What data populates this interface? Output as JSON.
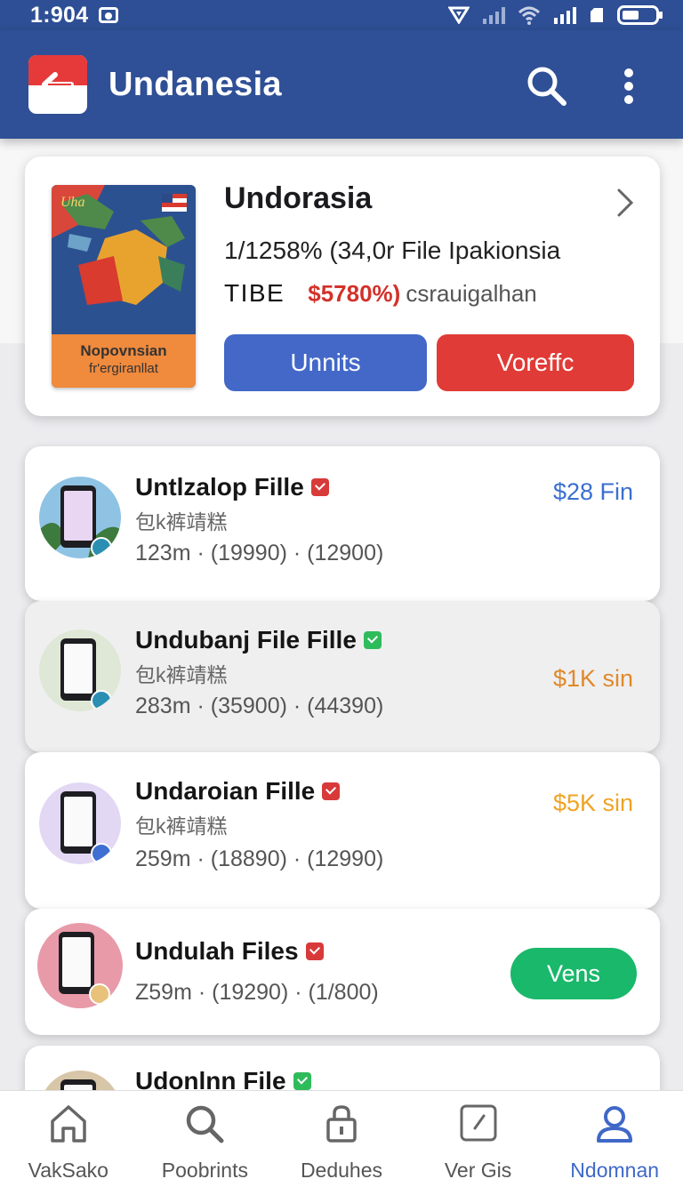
{
  "status_bar": {
    "time": "1:904"
  },
  "app_bar": {
    "title": "Undanesia"
  },
  "hero": {
    "title": "Undorasia",
    "line2": "1/1258% (34,0r File Ipakionsia",
    "tag": "TIBE",
    "price": "$5780%)",
    "price_note": "csrauigalhan",
    "book_title": "Nopovnsian",
    "book_subtitle": "fr'ergiranllat",
    "primary_button": "Unnits",
    "secondary_button": "Voreffc"
  },
  "list": [
    {
      "name": "Untlzalop Fille",
      "sub": "包k裤靖糕",
      "meta": "123m · (19990) · (12900)",
      "amount": "$28 Fin",
      "amount_color": "#3a6fd0",
      "badge": "red"
    },
    {
      "name": "Undubanj File Fille",
      "sub": "包k裤靖糕",
      "meta": "283m · (35900) · (44390)",
      "amount": "$1K sin",
      "amount_color": "#e0892a",
      "badge": "green"
    },
    {
      "name": "Undaroian Fille",
      "sub": "包k裤靖糕",
      "meta": "259m · (18890) · (12990)",
      "amount": "$5K sin",
      "amount_color": "#f0a323",
      "badge": "red"
    },
    {
      "name": "Undulah Files",
      "meta": "Z59m · (19290) · (1/800)",
      "button": "Vens",
      "badge": "red"
    },
    {
      "name": "Udonlnn File",
      "badge": "green"
    }
  ],
  "bottom_nav": [
    {
      "label": "VakSako",
      "icon": "home-icon"
    },
    {
      "label": "Poobrints",
      "icon": "search-icon"
    },
    {
      "label": "Deduhes",
      "icon": "lock-icon"
    },
    {
      "label": "Ver Gis",
      "icon": "edit-box-icon"
    },
    {
      "label": "Ndomnan",
      "icon": "profile-icon",
      "active": true
    }
  ],
  "colors": {
    "app_bar": "#2f5096",
    "accent_blue": "#4368c8",
    "accent_red": "#e03b36",
    "accent_green": "#19b86a"
  }
}
